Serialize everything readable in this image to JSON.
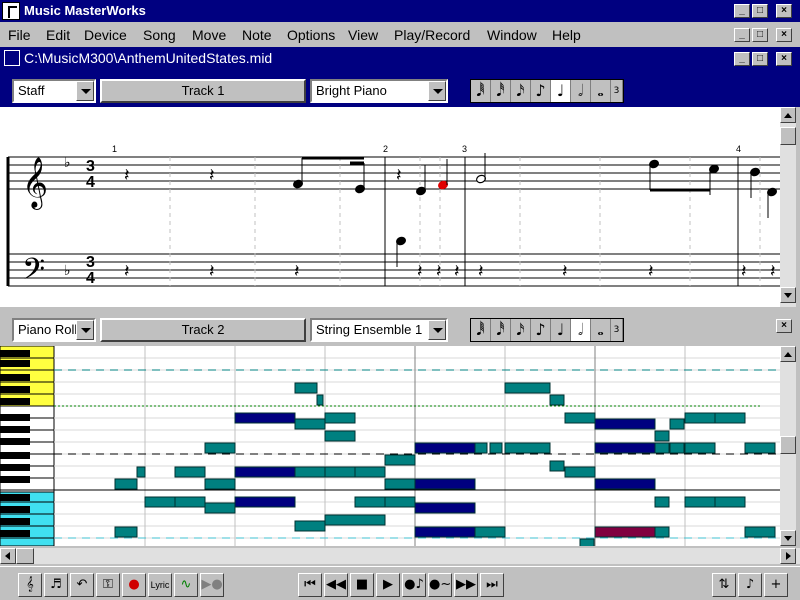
{
  "app": {
    "title": "Music MasterWorks",
    "icon": "music-app-icon",
    "window_buttons": [
      "_",
      "□",
      "×"
    ]
  },
  "menu": {
    "items": [
      "File",
      "Edit",
      "Device",
      "Song",
      "Move",
      "Note",
      "Options",
      "View",
      "Play/Record",
      "Window",
      "Help"
    ]
  },
  "document": {
    "title": "C:\\MusicM300\\AnthemUnitedStates.mid"
  },
  "track1": {
    "view_mode": "Staff",
    "track_label": "Track 1",
    "instrument": "Bright Piano",
    "note_buttons": [
      "𝅘𝅥𝅱",
      "𝅘𝅥𝅰",
      "𝅘𝅥𝅯",
      "♪",
      "♩",
      "𝅗𝅥",
      "𝅝",
      "3"
    ],
    "selected_note": 4,
    "measure_numbers": [
      "1",
      "2",
      "3",
      "4"
    ],
    "time_signature": {
      "top": "3",
      "bottom": "4"
    },
    "accent_note_color": "#e00000"
  },
  "track2": {
    "view_mode": "Piano Roll",
    "track_label": "Track 2",
    "instrument": "String Ensemble 1",
    "note_buttons": [
      "𝅘𝅥𝅱",
      "𝅘𝅥𝅰",
      "𝅘𝅥𝅯",
      "♪",
      "♩",
      "𝅗𝅥",
      "𝅝",
      "3"
    ],
    "selected_note": 5,
    "note_colors": {
      "dark": "#000080",
      "teal": "#008080",
      "selected": "#800040"
    }
  },
  "toolbar": {
    "left_buttons": [
      "piano-icon",
      "staff-icon",
      "undo-icon",
      "key-icon",
      "record-icon",
      "lyric-icon",
      "wave-icon",
      "marker-icon"
    ],
    "lyric_label": "Lyric",
    "transport": [
      "⏮",
      "◀◀",
      "■",
      "▶",
      "●♪",
      "●~",
      "▶▶|"
    ],
    "right_buttons": [
      "transpose-icon",
      "note-icon",
      "add-icon"
    ]
  }
}
